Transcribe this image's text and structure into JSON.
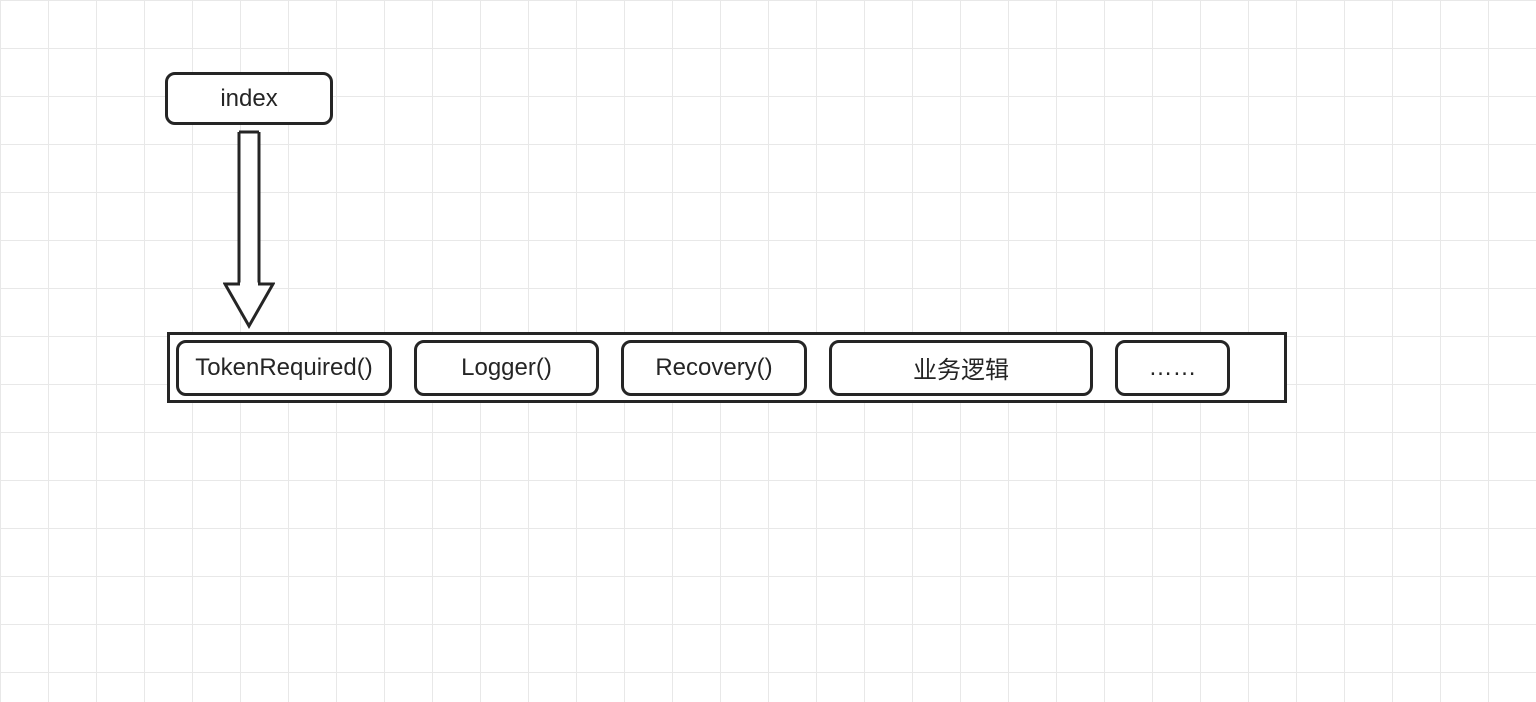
{
  "diagram": {
    "index_label": "index",
    "pipeline": {
      "items": [
        "TokenRequired()",
        "Logger()",
        "Recovery()",
        "业务逻辑",
        "……"
      ]
    }
  }
}
